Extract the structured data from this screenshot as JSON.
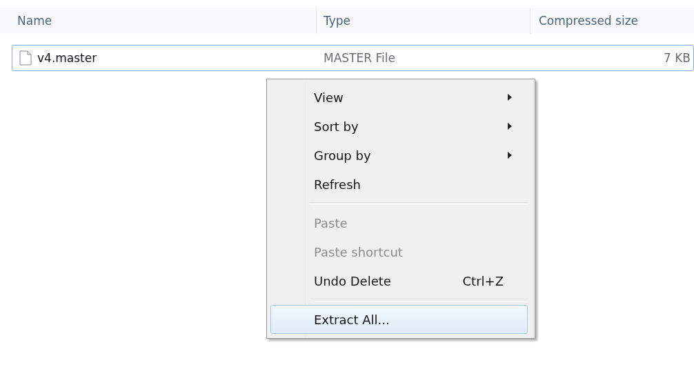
{
  "table": {
    "columns": [
      "Name",
      "Type",
      "Compressed size"
    ],
    "rows": [
      {
        "name": "v4.master",
        "type": "MASTER File",
        "size": "7 KB",
        "selected": true
      }
    ]
  },
  "context_menu": {
    "items": [
      {
        "kind": "item",
        "label": "View",
        "submenu": true,
        "disabled": false,
        "selected": false
      },
      {
        "kind": "item",
        "label": "Sort by",
        "submenu": true,
        "disabled": false,
        "selected": false
      },
      {
        "kind": "item",
        "label": "Group by",
        "submenu": true,
        "disabled": false,
        "selected": false
      },
      {
        "kind": "item",
        "label": "Refresh",
        "submenu": false,
        "disabled": false,
        "selected": false
      },
      {
        "kind": "separator"
      },
      {
        "kind": "item",
        "label": "Paste",
        "submenu": false,
        "disabled": true,
        "selected": false
      },
      {
        "kind": "item",
        "label": "Paste shortcut",
        "submenu": false,
        "disabled": true,
        "selected": false
      },
      {
        "kind": "item",
        "label": "Undo Delete",
        "shortcut": "Ctrl+Z",
        "submenu": false,
        "disabled": false,
        "selected": false
      },
      {
        "kind": "separator"
      },
      {
        "kind": "item",
        "label": "Extract All...",
        "submenu": false,
        "disabled": false,
        "selected": true
      }
    ]
  }
}
